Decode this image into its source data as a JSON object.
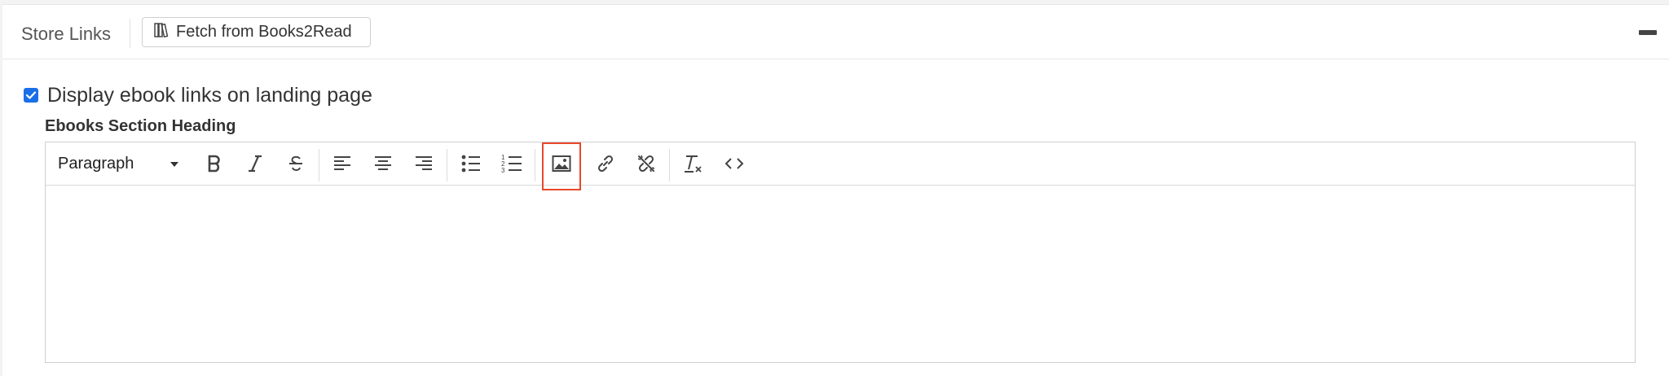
{
  "panel": {
    "title": "Store Links",
    "fetch_button_label": "Fetch from Books2Read",
    "collapse_icon": "minus-icon"
  },
  "display_option": {
    "checked": true,
    "label": "Display ebook links on landing page"
  },
  "editor": {
    "heading_label": "Ebooks Section Heading",
    "format_select_value": "Paragraph",
    "toolbar_icons": [
      "bold-icon",
      "italic-icon",
      "strikethrough-icon",
      "align-left-icon",
      "align-center-icon",
      "align-right-icon",
      "bulleted-list-icon",
      "numbered-list-icon",
      "insert-image-icon",
      "insert-link-icon",
      "remove-link-icon",
      "clear-formatting-icon",
      "source-code-icon"
    ],
    "content": ""
  },
  "colors": {
    "checkbox_accent": "#1a6fe8",
    "highlight_border": "#e8492b"
  }
}
